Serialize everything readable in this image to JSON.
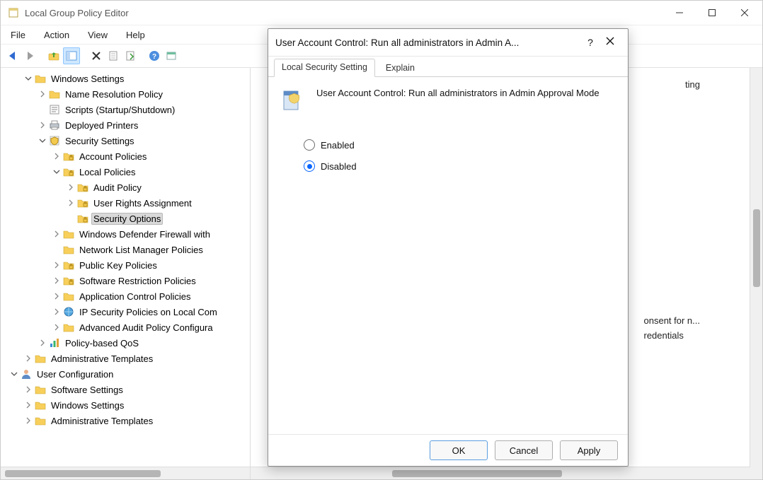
{
  "window": {
    "title": "Local Group Policy Editor",
    "menu": [
      "File",
      "Action",
      "View",
      "Help"
    ]
  },
  "tree": {
    "nodes": [
      {
        "d": 1,
        "e": "open",
        "i": "folder",
        "t": "Windows Settings"
      },
      {
        "d": 2,
        "e": "closed",
        "i": "folder",
        "t": "Name Resolution Policy"
      },
      {
        "d": 2,
        "e": "blank",
        "i": "script",
        "t": "Scripts (Startup/Shutdown)"
      },
      {
        "d": 2,
        "e": "closed",
        "i": "printer",
        "t": "Deployed Printers"
      },
      {
        "d": 2,
        "e": "open",
        "i": "shield",
        "t": "Security Settings"
      },
      {
        "d": 3,
        "e": "closed",
        "i": "folder-l",
        "t": "Account Policies"
      },
      {
        "d": 3,
        "e": "open",
        "i": "folder-l",
        "t": "Local Policies"
      },
      {
        "d": 4,
        "e": "closed",
        "i": "folder-l",
        "t": "Audit Policy"
      },
      {
        "d": 4,
        "e": "closed",
        "i": "folder-l",
        "t": "User Rights Assignment"
      },
      {
        "d": 4,
        "e": "blank",
        "i": "folder-l",
        "t": "Security Options",
        "sel": true
      },
      {
        "d": 3,
        "e": "closed",
        "i": "folder",
        "t": "Windows Defender Firewall with"
      },
      {
        "d": 3,
        "e": "blank",
        "i": "folder",
        "t": "Network List Manager Policies"
      },
      {
        "d": 3,
        "e": "closed",
        "i": "folder-l",
        "t": "Public Key Policies"
      },
      {
        "d": 3,
        "e": "closed",
        "i": "folder-l",
        "t": "Software Restriction Policies"
      },
      {
        "d": 3,
        "e": "closed",
        "i": "folder",
        "t": "Application Control Policies"
      },
      {
        "d": 3,
        "e": "closed",
        "i": "ipsec",
        "t": "IP Security Policies on Local Com"
      },
      {
        "d": 3,
        "e": "closed",
        "i": "folder",
        "t": "Advanced Audit Policy Configura"
      },
      {
        "d": 2,
        "e": "closed",
        "i": "qos",
        "t": "Policy-based QoS"
      },
      {
        "d": 1,
        "e": "closed",
        "i": "folder",
        "t": "Administrative Templates"
      },
      {
        "d": 0,
        "e": "open",
        "i": "user",
        "t": "User Configuration"
      },
      {
        "d": 1,
        "e": "closed",
        "i": "folder",
        "t": "Software Settings"
      },
      {
        "d": 1,
        "e": "closed",
        "i": "folder",
        "t": "Windows Settings"
      },
      {
        "d": 1,
        "e": "closed",
        "i": "folder",
        "t": "Administrative Templates"
      }
    ]
  },
  "right": {
    "peek1": "ting",
    "consent": "onsent for n...",
    "creds": "redentials"
  },
  "dialog": {
    "title": "User Account Control: Run all administrators in Admin A...",
    "help": "?",
    "tabs": {
      "setting": "Local Security Setting",
      "explain": "Explain"
    },
    "policy_name": "User Account Control: Run all administrators in Admin Approval Mode",
    "radio": {
      "enabled": "Enabled",
      "disabled": "Disabled",
      "selected": "disabled"
    },
    "buttons": {
      "ok": "OK",
      "cancel": "Cancel",
      "apply": "Apply"
    }
  }
}
